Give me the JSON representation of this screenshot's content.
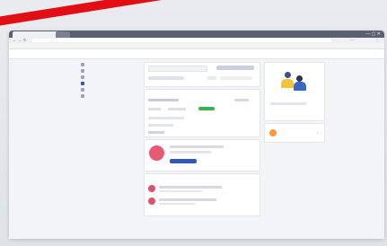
{
  "browser": {
    "tabs": [
      "",
      "",
      "",
      ""
    ],
    "url": "",
    "bookmarks": [
      "",
      "",
      "",
      "",
      "",
      "",
      "",
      "",
      "",
      ""
    ]
  },
  "app": {
    "logo": "",
    "page_title": "",
    "user_menu": ""
  },
  "sidebar": {
    "items": [
      {
        "label": ""
      },
      {
        "label": ""
      },
      {
        "label": ""
      },
      {
        "label": ""
      },
      {
        "label": ""
      },
      {
        "label": ""
      }
    ],
    "note": ""
  },
  "center": {
    "search_placeholder": "",
    "search_button": "",
    "activity_title": "",
    "status_badge": "",
    "status_color": "#37b24d",
    "promo_button": "",
    "promo_link": "",
    "feed_title": "",
    "feed_link": ""
  },
  "right": {
    "card_title": "",
    "card_link": "",
    "notification": ""
  },
  "colors": {
    "accent": "#3557b7",
    "red": "#e10f14",
    "avatar": "#e0506a",
    "promo_bg": "#e85a74"
  }
}
